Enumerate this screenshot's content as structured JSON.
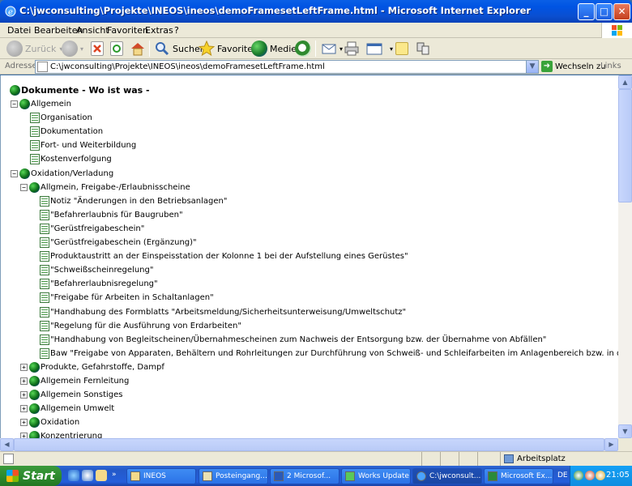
{
  "window": {
    "title": "C:\\jwconsulting\\Projekte\\INEOS\\ineos\\demoFramesetLeftFrame.html - Microsoft Internet Explorer",
    "min": "_",
    "max": "□",
    "close": "✕"
  },
  "menu": [
    "Datei",
    "Bearbeiten",
    "Ansicht",
    "Favoriten",
    "Extras",
    "?"
  ],
  "toolbar": {
    "back": "Zurück",
    "search": "Suchen",
    "favorites": "Favoriten",
    "media": "Medien"
  },
  "address": {
    "label": "Adresse",
    "url": "C:\\jwconsulting\\Projekte\\INEOS\\ineos\\demoFramesetLeftFrame.html",
    "go": "Wechseln zu",
    "links": "Links"
  },
  "tree": {
    "root": "Dokumente - Wo ist was -",
    "rows": [
      {
        "text": "Allgemein",
        "type": "folder",
        "expander": "⊟"
      },
      {
        "text": "Organisation",
        "type": "doc"
      },
      {
        "text": "Dokumentation",
        "type": "doc"
      },
      {
        "text": "Fort- und Weiterbildung",
        "type": "doc"
      },
      {
        "text": "Kostenverfolgung",
        "type": "doc"
      },
      {
        "text": "Oxidation/Verladung",
        "type": "folder",
        "expander": "⊟"
      },
      {
        "text": "Allgmein, Freigabe-/Erlaubnisscheine",
        "type": "folder",
        "expander": "⊟"
      },
      {
        "text": "Notiz \"Änderungen in den Betriebsanlagen\"",
        "type": "doc"
      },
      {
        "text": "\"Befahrerlaubnis für Baugruben\"",
        "type": "doc"
      },
      {
        "text": "\"Gerüstfreigabeschein\"",
        "type": "doc"
      },
      {
        "text": "\"Gerüstfreigabeschein (Ergänzung)\"",
        "type": "doc"
      },
      {
        "text": "Produktaustritt an der Einspeisstation der Kolonne 1 bei der Aufstellung eines Gerüstes\"",
        "type": "doc"
      },
      {
        "text": "\"Schweißscheinregelung\"",
        "type": "doc"
      },
      {
        "text": "\"Befahrerlaubnisregelung\"",
        "type": "doc"
      },
      {
        "text": "\"Freigabe für Arbeiten in Schaltanlagen\"",
        "type": "doc"
      },
      {
        "text": "\"Handhabung des Formblatts \"Arbeitsmeldung/Sicherheitsunterweisung/Umweltschutz\"",
        "type": "doc"
      },
      {
        "text": "\"Regelung für die Ausführung von Erdarbeiten\"",
        "type": "doc"
      },
      {
        "text": "\"Handhabung von Begleitscheinen/Übernahmescheinen zum Nachweis der Entsorgung bzw. der Übernahme von Abfällen\"",
        "type": "doc"
      },
      {
        "text": "Baw \"Freigabe von Apparaten, Behältern und Rohrleitungen zur Durchführung von Schweiß- und Schleifarbeiten im Anlagenbereich bzw. in d",
        "type": "doc"
      },
      {
        "text": "Produkte, Gefahrstoffe, Dampf",
        "type": "folder",
        "expander": "⊞"
      },
      {
        "text": "Allgemein Fernleitung",
        "type": "folder",
        "expander": "⊞"
      },
      {
        "text": "Allgemein Sonstiges",
        "type": "folder",
        "expander": "⊞"
      },
      {
        "text": "Allgemein Umwelt",
        "type": "folder",
        "expander": "⊞"
      },
      {
        "text": "Oxidation",
        "type": "folder",
        "expander": "⊞"
      },
      {
        "text": "Konzentrierung",
        "type": "folder",
        "expander": "⊞"
      }
    ]
  },
  "status": {
    "zone": "Arbeitsplatz"
  },
  "taskbar": {
    "start": "Start",
    "tasks": [
      "INEOS",
      "Posteingang...",
      "2 Microsof...",
      "Works Update",
      "C:\\jwconsult...",
      "Microsoft Ex..."
    ],
    "lang": "DE",
    "clock": "21:05"
  }
}
